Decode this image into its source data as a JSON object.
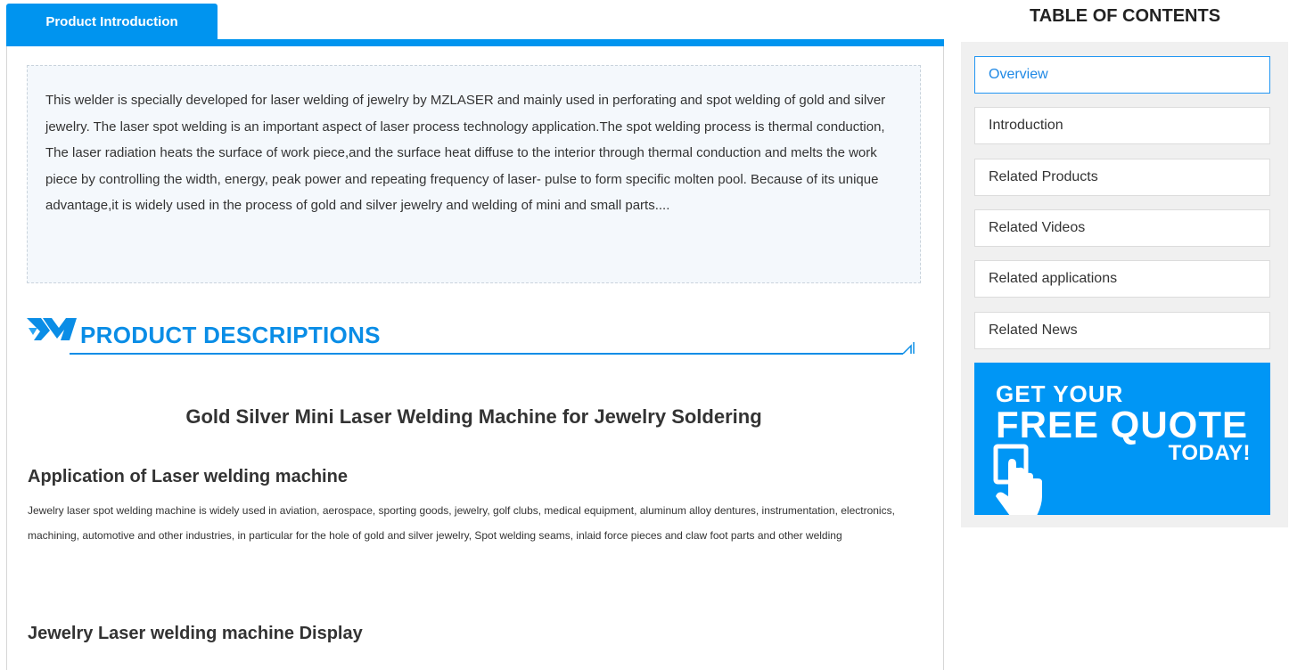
{
  "tab": {
    "label": "Product Introduction"
  },
  "intro": {
    "text": "This welder is specially developed for laser welding of jewelry by MZLASER and mainly used in perforating and spot welding of gold and silver jewelry. The laser spot welding is an important aspect of laser process technology application.The spot welding process is thermal conduction, The laser radiation heats the surface of work piece,and the surface heat diffuse to the interior through thermal conduction and melts the work piece by controlling the width, energy, peak power and repeating frequency of laser- pulse to form specific molten pool. Because of its unique advantage,it is widely used in the process of gold and silver jewelry and welding of mini and small parts...."
  },
  "section": {
    "title": "PRODUCT DESCRIPTIONS",
    "product_title": "Gold Silver Mini Laser Welding Machine for Jewelry Soldering",
    "application_heading": "Application of Laser welding machine",
    "application_text": "Jewelry laser spot welding machine is widely used in aviation, aerospace, sporting goods, jewelry, golf clubs, medical equipment, aluminum alloy dentures, instrumentation, electronics, machining, automotive and other industries, in particular for the hole of gold and silver jewelry, Spot welding seams, inlaid force pieces and claw foot parts and other welding",
    "display_heading": "Jewelry Laser welding machine Display"
  },
  "toc": {
    "title": "TABLE OF CONTENTS",
    "items": [
      {
        "label": "Overview",
        "active": true
      },
      {
        "label": "Introduction",
        "active": false
      },
      {
        "label": "Related Products",
        "active": false
      },
      {
        "label": "Related Videos",
        "active": false
      },
      {
        "label": "Related applications",
        "active": false
      },
      {
        "label": "Related News",
        "active": false
      }
    ]
  },
  "quote_banner": {
    "line1": "GET YOUR",
    "line2": "FREE QUOTE",
    "line3": "TODAY!"
  },
  "colors": {
    "accent": "#0094ef",
    "heading_blue": "#0a8de6",
    "intro_bg": "#f4f8fc",
    "sidebar_bg": "#f0f0f0"
  }
}
